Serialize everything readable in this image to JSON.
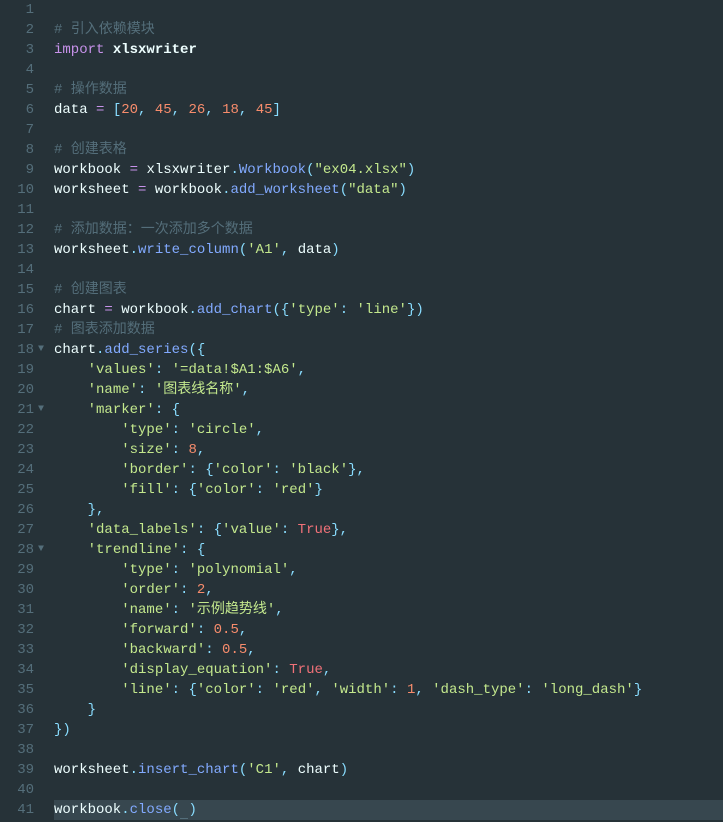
{
  "lines": [
    {
      "n": 1,
      "fold": "",
      "tokens": []
    },
    {
      "n": 2,
      "fold": "",
      "tokens": [
        [
          "cmt",
          "# 引入依赖模块"
        ]
      ]
    },
    {
      "n": 3,
      "fold": "",
      "tokens": [
        [
          "kw",
          "import"
        ],
        [
          "sp",
          " "
        ],
        [
          "mod",
          "xlsxwriter"
        ]
      ]
    },
    {
      "n": 4,
      "fold": "",
      "tokens": []
    },
    {
      "n": 5,
      "fold": "",
      "tokens": [
        [
          "cmt",
          "# 操作数据"
        ]
      ]
    },
    {
      "n": 6,
      "fold": "",
      "tokens": [
        [
          "id",
          "data"
        ],
        [
          "sp",
          " "
        ],
        [
          "eq",
          "="
        ],
        [
          "sp",
          " "
        ],
        [
          "pun",
          "["
        ],
        [
          "num",
          "20"
        ],
        [
          "pun",
          ","
        ],
        [
          "sp",
          " "
        ],
        [
          "num",
          "45"
        ],
        [
          "pun",
          ","
        ],
        [
          "sp",
          " "
        ],
        [
          "num",
          "26"
        ],
        [
          "pun",
          ","
        ],
        [
          "sp",
          " "
        ],
        [
          "num",
          "18"
        ],
        [
          "pun",
          ","
        ],
        [
          "sp",
          " "
        ],
        [
          "num",
          "45"
        ],
        [
          "pun",
          "]"
        ]
      ]
    },
    {
      "n": 7,
      "fold": "",
      "tokens": []
    },
    {
      "n": 8,
      "fold": "",
      "tokens": [
        [
          "cmt",
          "# 创建表格"
        ]
      ]
    },
    {
      "n": 9,
      "fold": "",
      "tokens": [
        [
          "id",
          "workbook"
        ],
        [
          "sp",
          " "
        ],
        [
          "eq",
          "="
        ],
        [
          "sp",
          " "
        ],
        [
          "id",
          "xlsxwriter"
        ],
        [
          "dot",
          "."
        ],
        [
          "meth",
          "Workbook"
        ],
        [
          "pun",
          "("
        ],
        [
          "str",
          "\"ex04.xlsx\""
        ],
        [
          "pun",
          ")"
        ]
      ]
    },
    {
      "n": 10,
      "fold": "",
      "tokens": [
        [
          "id",
          "worksheet"
        ],
        [
          "sp",
          " "
        ],
        [
          "eq",
          "="
        ],
        [
          "sp",
          " "
        ],
        [
          "id",
          "workbook"
        ],
        [
          "dot",
          "."
        ],
        [
          "meth",
          "add_worksheet"
        ],
        [
          "pun",
          "("
        ],
        [
          "str",
          "\"data\""
        ],
        [
          "pun",
          ")"
        ]
      ]
    },
    {
      "n": 11,
      "fold": "",
      "tokens": []
    },
    {
      "n": 12,
      "fold": "",
      "tokens": [
        [
          "cmt",
          "# 添加数据：一次添加多个数据"
        ]
      ]
    },
    {
      "n": 13,
      "fold": "",
      "tokens": [
        [
          "id",
          "worksheet"
        ],
        [
          "dot",
          "."
        ],
        [
          "meth",
          "write_column"
        ],
        [
          "pun",
          "("
        ],
        [
          "str",
          "'A1'"
        ],
        [
          "pun",
          ","
        ],
        [
          "sp",
          " "
        ],
        [
          "id",
          "data"
        ],
        [
          "pun",
          ")"
        ]
      ]
    },
    {
      "n": 14,
      "fold": "",
      "tokens": []
    },
    {
      "n": 15,
      "fold": "",
      "tokens": [
        [
          "cmt",
          "# 创建图表"
        ]
      ]
    },
    {
      "n": 16,
      "fold": "",
      "tokens": [
        [
          "id",
          "chart"
        ],
        [
          "sp",
          " "
        ],
        [
          "eq",
          "="
        ],
        [
          "sp",
          " "
        ],
        [
          "id",
          "workbook"
        ],
        [
          "dot",
          "."
        ],
        [
          "meth",
          "add_chart"
        ],
        [
          "pun",
          "({"
        ],
        [
          "str",
          "'type'"
        ],
        [
          "pun",
          ":"
        ],
        [
          "sp",
          " "
        ],
        [
          "str",
          "'line'"
        ],
        [
          "pun",
          "})"
        ]
      ]
    },
    {
      "n": 17,
      "fold": "",
      "tokens": [
        [
          "cmt",
          "# 图表添加数据"
        ]
      ]
    },
    {
      "n": 18,
      "fold": "▼",
      "tokens": [
        [
          "id",
          "chart"
        ],
        [
          "dot",
          "."
        ],
        [
          "meth",
          "add_series"
        ],
        [
          "pun",
          "({"
        ]
      ]
    },
    {
      "n": 19,
      "fold": "",
      "tokens": [
        [
          "sp",
          "    "
        ],
        [
          "str",
          "'values'"
        ],
        [
          "pun",
          ":"
        ],
        [
          "sp",
          " "
        ],
        [
          "str",
          "'=data!$A1:$A6'"
        ],
        [
          "pun",
          ","
        ]
      ]
    },
    {
      "n": 20,
      "fold": "",
      "tokens": [
        [
          "sp",
          "    "
        ],
        [
          "str",
          "'name'"
        ],
        [
          "pun",
          ":"
        ],
        [
          "sp",
          " "
        ],
        [
          "str",
          "'图表线名称'"
        ],
        [
          "pun",
          ","
        ]
      ]
    },
    {
      "n": 21,
      "fold": "▼",
      "tokens": [
        [
          "sp",
          "    "
        ],
        [
          "str",
          "'marker'"
        ],
        [
          "pun",
          ":"
        ],
        [
          "sp",
          " "
        ],
        [
          "pun",
          "{"
        ]
      ]
    },
    {
      "n": 22,
      "fold": "",
      "tokens": [
        [
          "sp",
          "        "
        ],
        [
          "str",
          "'type'"
        ],
        [
          "pun",
          ":"
        ],
        [
          "sp",
          " "
        ],
        [
          "str",
          "'circle'"
        ],
        [
          "pun",
          ","
        ]
      ]
    },
    {
      "n": 23,
      "fold": "",
      "tokens": [
        [
          "sp",
          "        "
        ],
        [
          "str",
          "'size'"
        ],
        [
          "pun",
          ":"
        ],
        [
          "sp",
          " "
        ],
        [
          "num",
          "8"
        ],
        [
          "pun",
          ","
        ]
      ]
    },
    {
      "n": 24,
      "fold": "",
      "tokens": [
        [
          "sp",
          "        "
        ],
        [
          "str",
          "'border'"
        ],
        [
          "pun",
          ":"
        ],
        [
          "sp",
          " "
        ],
        [
          "pun",
          "{"
        ],
        [
          "str",
          "'color'"
        ],
        [
          "pun",
          ":"
        ],
        [
          "sp",
          " "
        ],
        [
          "str",
          "'black'"
        ],
        [
          "pun",
          "},"
        ]
      ]
    },
    {
      "n": 25,
      "fold": "",
      "tokens": [
        [
          "sp",
          "        "
        ],
        [
          "str",
          "'fill'"
        ],
        [
          "pun",
          ":"
        ],
        [
          "sp",
          " "
        ],
        [
          "pun",
          "{"
        ],
        [
          "str",
          "'color'"
        ],
        [
          "pun",
          ":"
        ],
        [
          "sp",
          " "
        ],
        [
          "str",
          "'red'"
        ],
        [
          "pun",
          "}"
        ]
      ]
    },
    {
      "n": 26,
      "fold": "",
      "tokens": [
        [
          "sp",
          "    "
        ],
        [
          "pun",
          "},"
        ]
      ]
    },
    {
      "n": 27,
      "fold": "",
      "tokens": [
        [
          "sp",
          "    "
        ],
        [
          "str",
          "'data_labels'"
        ],
        [
          "pun",
          ":"
        ],
        [
          "sp",
          " "
        ],
        [
          "pun",
          "{"
        ],
        [
          "str",
          "'value'"
        ],
        [
          "pun",
          ":"
        ],
        [
          "sp",
          " "
        ],
        [
          "bool",
          "True"
        ],
        [
          "pun",
          "},"
        ]
      ]
    },
    {
      "n": 28,
      "fold": "▼",
      "tokens": [
        [
          "sp",
          "    "
        ],
        [
          "str",
          "'trendline'"
        ],
        [
          "pun",
          ":"
        ],
        [
          "sp",
          " "
        ],
        [
          "pun",
          "{"
        ]
      ]
    },
    {
      "n": 29,
      "fold": "",
      "tokens": [
        [
          "sp",
          "        "
        ],
        [
          "str",
          "'type'"
        ],
        [
          "pun",
          ":"
        ],
        [
          "sp",
          " "
        ],
        [
          "str",
          "'polynomial'"
        ],
        [
          "pun",
          ","
        ]
      ]
    },
    {
      "n": 30,
      "fold": "",
      "tokens": [
        [
          "sp",
          "        "
        ],
        [
          "str",
          "'order'"
        ],
        [
          "pun",
          ":"
        ],
        [
          "sp",
          " "
        ],
        [
          "num",
          "2"
        ],
        [
          "pun",
          ","
        ]
      ]
    },
    {
      "n": 31,
      "fold": "",
      "tokens": [
        [
          "sp",
          "        "
        ],
        [
          "str",
          "'name'"
        ],
        [
          "pun",
          ":"
        ],
        [
          "sp",
          " "
        ],
        [
          "str",
          "'示例趋势线'"
        ],
        [
          "pun",
          ","
        ]
      ]
    },
    {
      "n": 32,
      "fold": "",
      "tokens": [
        [
          "sp",
          "        "
        ],
        [
          "str",
          "'forward'"
        ],
        [
          "pun",
          ":"
        ],
        [
          "sp",
          " "
        ],
        [
          "num",
          "0.5"
        ],
        [
          "pun",
          ","
        ]
      ]
    },
    {
      "n": 33,
      "fold": "",
      "tokens": [
        [
          "sp",
          "        "
        ],
        [
          "str",
          "'backward'"
        ],
        [
          "pun",
          ":"
        ],
        [
          "sp",
          " "
        ],
        [
          "num",
          "0.5"
        ],
        [
          "pun",
          ","
        ]
      ]
    },
    {
      "n": 34,
      "fold": "",
      "tokens": [
        [
          "sp",
          "        "
        ],
        [
          "str",
          "'display_equation'"
        ],
        [
          "pun",
          ":"
        ],
        [
          "sp",
          " "
        ],
        [
          "bool",
          "True"
        ],
        [
          "pun",
          ","
        ]
      ]
    },
    {
      "n": 35,
      "fold": "",
      "tokens": [
        [
          "sp",
          "        "
        ],
        [
          "str",
          "'line'"
        ],
        [
          "pun",
          ":"
        ],
        [
          "sp",
          " "
        ],
        [
          "pun",
          "{"
        ],
        [
          "str",
          "'color'"
        ],
        [
          "pun",
          ":"
        ],
        [
          "sp",
          " "
        ],
        [
          "str",
          "'red'"
        ],
        [
          "pun",
          ","
        ],
        [
          "sp",
          " "
        ],
        [
          "str",
          "'width'"
        ],
        [
          "pun",
          ":"
        ],
        [
          "sp",
          " "
        ],
        [
          "num",
          "1"
        ],
        [
          "pun",
          ","
        ],
        [
          "sp",
          " "
        ],
        [
          "str",
          "'dash_type'"
        ],
        [
          "pun",
          ":"
        ],
        [
          "sp",
          " "
        ],
        [
          "str",
          "'long_dash'"
        ],
        [
          "pun",
          "}"
        ]
      ]
    },
    {
      "n": 36,
      "fold": "",
      "tokens": [
        [
          "sp",
          "    "
        ],
        [
          "pun",
          "}"
        ]
      ]
    },
    {
      "n": 37,
      "fold": "",
      "tokens": [
        [
          "pun",
          "})"
        ]
      ]
    },
    {
      "n": 38,
      "fold": "",
      "tokens": []
    },
    {
      "n": 39,
      "fold": "",
      "tokens": [
        [
          "id",
          "worksheet"
        ],
        [
          "dot",
          "."
        ],
        [
          "meth",
          "insert_chart"
        ],
        [
          "pun",
          "("
        ],
        [
          "str",
          "'C1'"
        ],
        [
          "pun",
          ","
        ],
        [
          "sp",
          " "
        ],
        [
          "id",
          "chart"
        ],
        [
          "pun",
          ")"
        ]
      ]
    },
    {
      "n": 40,
      "fold": "",
      "tokens": []
    },
    {
      "n": 41,
      "fold": "",
      "hl": true,
      "tokens": [
        [
          "id",
          "workbook"
        ],
        [
          "dot",
          "."
        ],
        [
          "meth",
          "close"
        ],
        [
          "pun",
          "("
        ],
        [
          "cursor",
          ""
        ],
        [
          "pun",
          ")"
        ]
      ]
    }
  ],
  "token_class_map": {
    "cmt": "c-cmt",
    "kw": "c-kw",
    "mod": "c-mod",
    "id": "c-id",
    "meth": "c-meth",
    "str": "c-str",
    "num": "c-num",
    "pun": "c-pun",
    "bool": "c-bool",
    "dot": "c-dot",
    "eq": "c-eq",
    "sp": "",
    "cursor": "underline"
  }
}
